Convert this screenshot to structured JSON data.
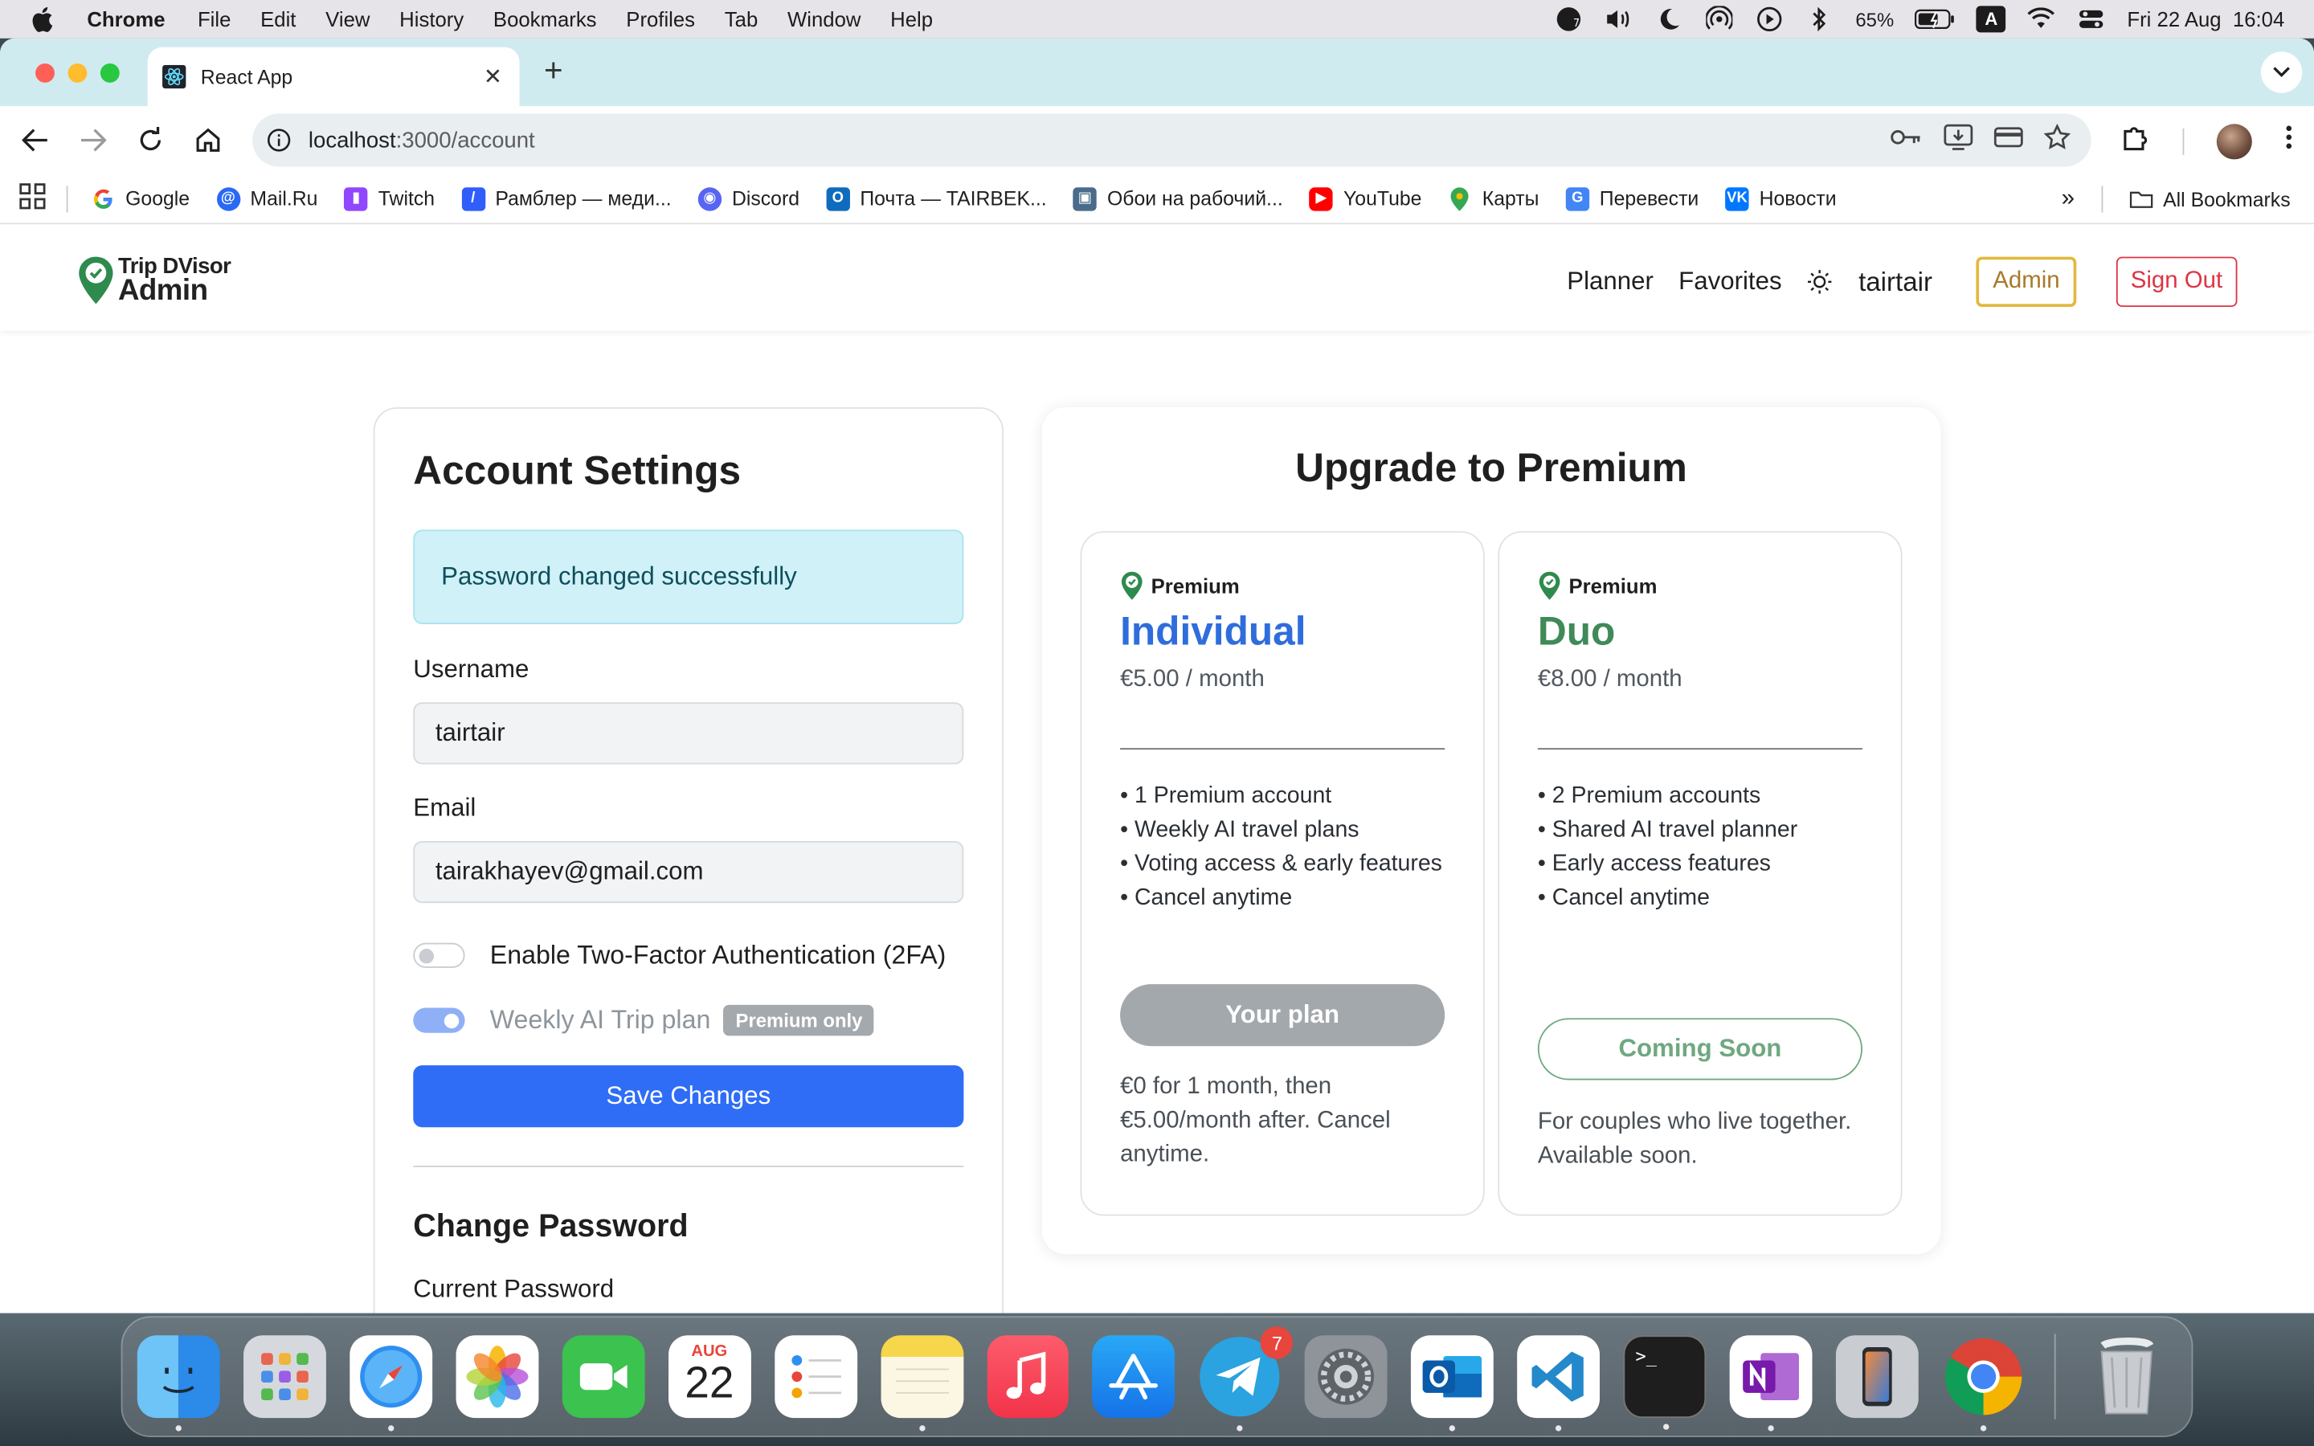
{
  "menubar": {
    "app": "Chrome",
    "items": [
      "File",
      "Edit",
      "View",
      "History",
      "Bookmarks",
      "Profiles",
      "Tab",
      "Window",
      "Help"
    ],
    "battery": "65%",
    "input_source": "A",
    "datetime": "Fri 22 Aug  16:04"
  },
  "browser": {
    "tab_title": "React App",
    "url_host": "localhost",
    "url_path": ":3000/account",
    "bookmarks": [
      {
        "label": "Google",
        "icon": "google-icon",
        "color": "#4285f4"
      },
      {
        "label": "Mail.Ru",
        "icon": "mailru-icon",
        "color": "#2a69f5"
      },
      {
        "label": "Twitch",
        "icon": "twitch-icon",
        "color": "#9146ff"
      },
      {
        "label": "Рамблер — меди...",
        "icon": "rambler-icon",
        "color": "#315efb"
      },
      {
        "label": "Discord",
        "icon": "discord-icon",
        "color": "#5865f2"
      },
      {
        "label": "Почта — TAIRBEK...",
        "icon": "outlook-icon",
        "color": "#0f6cbd"
      },
      {
        "label": "Обои на рабочий...",
        "icon": "wallpaper-icon",
        "color": "#4a6b8a"
      },
      {
        "label": "YouTube",
        "icon": "youtube-icon",
        "color": "#ff0000"
      },
      {
        "label": "Карты",
        "icon": "maps-icon",
        "color": "#34a853"
      },
      {
        "label": "Перевести",
        "icon": "translate-icon",
        "color": "#4285f4"
      },
      {
        "label": "Новости",
        "icon": "vk-icon",
        "color": "#0077ff"
      }
    ],
    "all_bookmarks": "All Bookmarks"
  },
  "app": {
    "brand_line1": "Trip DVisor",
    "brand_line2": "Admin",
    "nav": {
      "planner": "Planner",
      "favorites": "Favorites",
      "username": "tairtair",
      "admin": "Admin",
      "sign_out": "Sign Out"
    },
    "settings": {
      "title": "Account Settings",
      "alert": "Password changed successfully",
      "username_label": "Username",
      "username_value": "tairtair",
      "email_label": "Email",
      "email_value": "tairakhayev@gmail.com",
      "twofa_label": "Enable Two-Factor Authentication (2FA)",
      "twofa_enabled": false,
      "weekly_label": "Weekly AI Trip plan",
      "weekly_enabled": true,
      "premium_badge": "Premium only",
      "save_button": "Save Changes",
      "change_password_title": "Change Password",
      "current_password_label": "Current Password"
    },
    "premium": {
      "title": "Upgrade to Premium",
      "plans": [
        {
          "tag": "Premium",
          "name": "Individual",
          "name_color": "#2f6ddc",
          "price": "€5.00 / month",
          "features": [
            "• 1 Premium account",
            "• Weekly AI travel plans",
            "• Voting access & early features",
            "• Cancel anytime"
          ],
          "button": "Your plan",
          "note": "€0 for 1 month, then €5.00/month after. Cancel anytime."
        },
        {
          "tag": "Premium",
          "name": "Duo",
          "name_color": "#3f8a58",
          "price": "€8.00 / month",
          "features": [
            "• 2 Premium accounts",
            "• Shared AI travel planner",
            "• Early access features",
            "• Cancel anytime"
          ],
          "button": "Coming Soon",
          "note": "For couples who live together. Available soon."
        }
      ]
    }
  },
  "dock": {
    "calendar_month": "AUG",
    "calendar_day": "22",
    "telegram_badge": "7",
    "apps": [
      "finder",
      "launchpad",
      "safari",
      "photos",
      "facetime",
      "calendar",
      "reminders",
      "notes",
      "music",
      "app-store",
      "telegram",
      "system-settings",
      "outlook",
      "vscode",
      "terminal",
      "onenote",
      "iphone-mirroring",
      "chrome",
      "trash"
    ]
  },
  "colors": {
    "primary": "#2f6df6",
    "brand_green": "#3f8a58",
    "alert_bg": "#d1f1f8",
    "danger": "#dc3545",
    "admin_gold": "#e3b83d"
  }
}
